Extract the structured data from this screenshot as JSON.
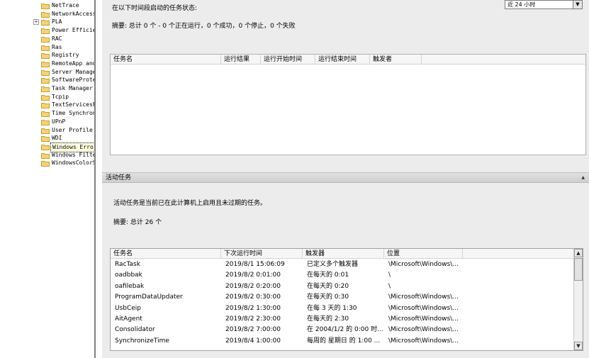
{
  "tree": {
    "items": [
      {
        "label": "NetTrace",
        "expandable": false,
        "selected": false
      },
      {
        "label": "NetworkAccess",
        "expandable": false,
        "selected": false
      },
      {
        "label": "PLA",
        "expandable": true,
        "selected": false
      },
      {
        "label": "Power Efficie",
        "expandable": false,
        "selected": false
      },
      {
        "label": "RAC",
        "expandable": false,
        "selected": false
      },
      {
        "label": "Ras",
        "expandable": false,
        "selected": false
      },
      {
        "label": "Registry",
        "expandable": false,
        "selected": false
      },
      {
        "label": "RemoteApp and",
        "expandable": false,
        "selected": false
      },
      {
        "label": "Server Manage",
        "expandable": false,
        "selected": false
      },
      {
        "label": "SoftwareProte",
        "expandable": false,
        "selected": false
      },
      {
        "label": "Task Manager",
        "expandable": false,
        "selected": false
      },
      {
        "label": "Tcpip",
        "expandable": false,
        "selected": false
      },
      {
        "label": "TextServicesF",
        "expandable": false,
        "selected": false
      },
      {
        "label": "Time Synchron",
        "expandable": false,
        "selected": false
      },
      {
        "label": "UPnP",
        "expandable": false,
        "selected": false
      },
      {
        "label": "User Profile",
        "expandable": false,
        "selected": false
      },
      {
        "label": "WDI",
        "expandable": false,
        "selected": false
      },
      {
        "label": "Windows Error Reporting",
        "expandable": false,
        "selected": true
      },
      {
        "label": "Windows Filte",
        "expandable": false,
        "selected": false
      },
      {
        "label": "WindowsColorS",
        "expandable": false,
        "selected": false
      }
    ],
    "expander_symbol": "+"
  },
  "upper": {
    "status_label": "在以下时间段启动的任务状态:",
    "range_value": "近 24 小时",
    "summary": "摘要: 总计 0 个 - 0 个正在运行，0 个成功，0 个停止，0 个失败",
    "columns": [
      "任务名",
      "运行结果",
      "运行开始时间",
      "运行结束时间",
      "触发者"
    ]
  },
  "active": {
    "title": "活动任务",
    "description": "活动任务是当前已在此计算机上启用且未过期的任务。",
    "summary": "摘要: 总计 26 个",
    "columns": [
      "任务名",
      "下次运行时间",
      "触发器",
      "位置"
    ],
    "rows": [
      [
        "RacTask",
        "2019/8/1 15:06:09",
        "已定义多个触发器",
        "\\Microsoft\\Windows\\..."
      ],
      [
        "oadbbak",
        "2019/8/2 0:01:00",
        "在每天的 0:01",
        "\\"
      ],
      [
        "oafilebak",
        "2019/8/2 0:20:00",
        "在每天的 0:20",
        "\\"
      ],
      [
        "ProgramDataUpdater",
        "2019/8/2 0:30:00",
        "在每天的 0:30",
        "\\Microsoft\\Windows\\..."
      ],
      [
        "UsbCeip",
        "2019/8/2 1:30:00",
        "在每 3 天的 1:30",
        "\\Microsoft\\Windows\\..."
      ],
      [
        "AitAgent",
        "2019/8/2 2:30:00",
        "在每天的 2:30",
        "\\Microsoft\\Windows\\..."
      ],
      [
        "Consolidator",
        "2019/8/2 7:00:00",
        "在 2004/1/2 的 0:00 时...",
        "\\Microsoft\\Windows\\..."
      ],
      [
        "SynchronizeTime",
        "2019/8/4 1:00:00",
        "每周的 星期日 的 1:00 ...",
        "\\Microsoft\\Windows\\..."
      ]
    ]
  },
  "icons": {
    "folder": "folder-icon",
    "dropdown": "chevron-down-icon",
    "collapse": "collapse-up-icon",
    "scroll_up": "scroll-up-icon",
    "scroll_down": "scroll-down-icon"
  },
  "glyphs": {
    "dropdown": "▼",
    "collapse": "▲",
    "scroll_up": "▲",
    "scroll_down": "▼"
  },
  "colors": {
    "folder_fill": "#f3d37a",
    "folder_stroke": "#c7a030",
    "panel_bg": "#ececec"
  }
}
